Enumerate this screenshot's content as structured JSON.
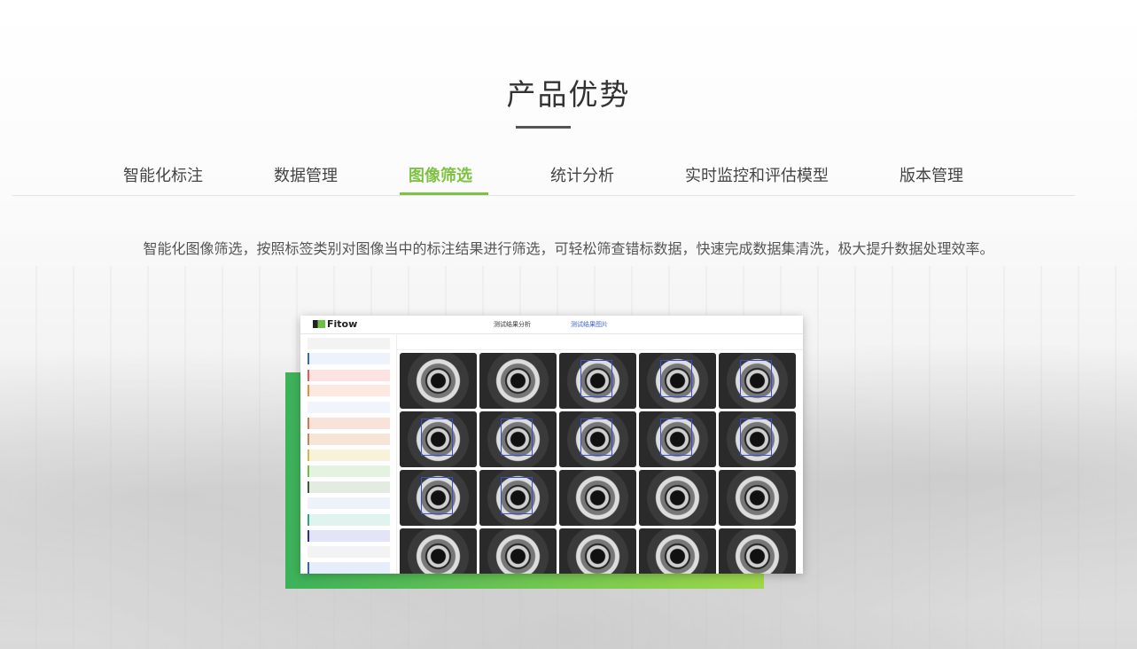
{
  "section": {
    "title": "产品优势",
    "tabs": [
      {
        "label": "智能化标注",
        "active": false
      },
      {
        "label": "数据管理",
        "active": false
      },
      {
        "label": "图像筛选",
        "active": true
      },
      {
        "label": "统计分析",
        "active": false
      },
      {
        "label": "实时监控和评估模型",
        "active": false
      },
      {
        "label": "版本管理",
        "active": false
      }
    ],
    "description": "智能化图像筛选，按照标签类别对图像当中的标注结果进行筛选，可轻松筛查错标数据，快速完成数据集清洗，极大提升数据处理效率。",
    "accent_color": "#7dc243"
  },
  "screenshot": {
    "logo": "Fitow",
    "tabs": [
      {
        "label": "测试结果分析"
      },
      {
        "label": "测试结果图片"
      }
    ]
  }
}
